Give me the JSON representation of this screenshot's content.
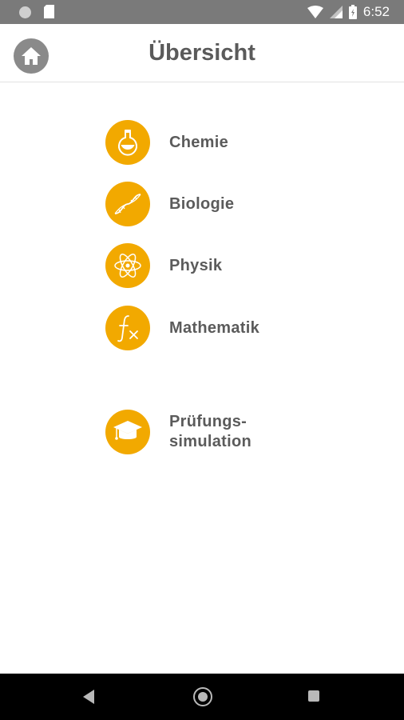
{
  "status_bar": {
    "time": "6:52",
    "icons": [
      "notification-dot-icon",
      "sd-card-icon",
      "wifi-icon",
      "cell-signal-icon",
      "battery-icon"
    ]
  },
  "header": {
    "title": "Übersicht",
    "home_icon": "home-icon"
  },
  "menu": {
    "items": [
      {
        "label": "Chemie",
        "icon": "flask-icon"
      },
      {
        "label": "Biologie",
        "icon": "dna-icon"
      },
      {
        "label": "Physik",
        "icon": "atom-icon"
      },
      {
        "label": "Mathematik",
        "icon": "function-icon"
      }
    ],
    "exam": {
      "label_line1": "Prüfungs-",
      "label_line2": "simulation",
      "icon": "graduation-cap-icon"
    }
  },
  "nav_bar": {
    "icons": [
      "back-icon",
      "home-circle-icon",
      "recents-icon"
    ]
  },
  "colors": {
    "accent": "#f2a900",
    "status_bar": "#7a7a7a",
    "text": "#5b5b5b",
    "nav_bar": "#000000"
  }
}
